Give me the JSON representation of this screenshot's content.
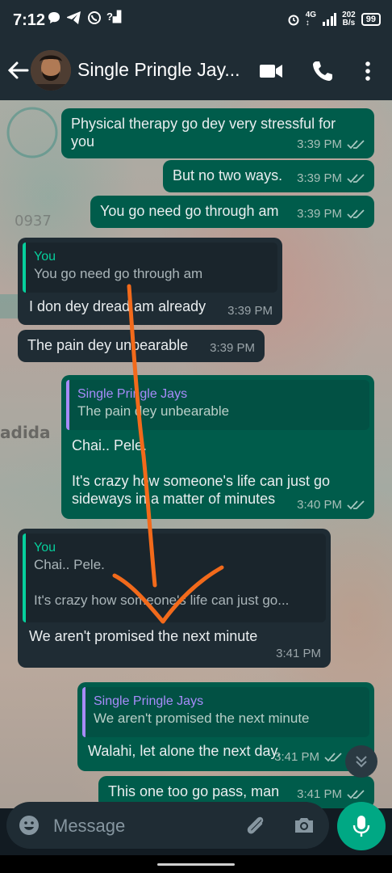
{
  "status_bar": {
    "time": "7:12",
    "left_icons": [
      "chat-bubble-icon",
      "telegram-icon",
      "whatsapp-icon",
      "signal-icon"
    ],
    "signal_label": "?",
    "network_label": "4G",
    "net_speed": "202",
    "net_speed_unit": "B/s",
    "battery": "99"
  },
  "header": {
    "contact_name": "Single Pringle Jay...",
    "icons": [
      "back-arrow-icon",
      "video-call-icon",
      "phone-icon",
      "more-vert-icon"
    ]
  },
  "messages": [
    {
      "dir": "out",
      "text": "Physical therapy go dey very stressful for you",
      "time": "3:39 PM",
      "ticks": "read"
    },
    {
      "dir": "out",
      "text": "But no two ways.",
      "time": "3:39 PM",
      "ticks": "read"
    },
    {
      "dir": "out",
      "text": "You go need go through am",
      "time": "3:39 PM",
      "ticks": "read"
    },
    {
      "dir": "in",
      "quote_author": "You",
      "quote_text": "You go need go through am",
      "text": "I don dey dread am already",
      "time": "3:39 PM"
    },
    {
      "dir": "in",
      "text": "The pain dey unbearable",
      "time": "3:39 PM"
    },
    {
      "dir": "out",
      "quote_author": "Single Pringle Jays",
      "quote_text": "The pain dey unbearable",
      "text_line1": "Chai.. Pele.",
      "text_line2": "It's crazy how someone's life can just go sideways in a matter of minutes",
      "time": "3:40 PM",
      "ticks": "read"
    },
    {
      "dir": "in",
      "quote_author": "You",
      "quote_text_line1": "Chai.. Pele.",
      "quote_text_line2": "It's crazy how someone's life can just go...",
      "text": "We aren't promised the next minute",
      "time": "3:41 PM"
    },
    {
      "dir": "out",
      "quote_author": "Single Pringle Jays",
      "quote_text": "We aren't promised the next minute",
      "text": "Walahi, let alone the next day.",
      "time": "3:41 PM",
      "ticks": "read"
    },
    {
      "dir": "out",
      "text": "This one too go pass, man",
      "time": "3:41 PM",
      "ticks": "read"
    }
  ],
  "composer": {
    "placeholder": "Message",
    "icons": [
      "emoji-icon",
      "attach-icon",
      "camera-icon",
      "mic-icon"
    ]
  },
  "colors": {
    "outgoing_bubble": "#005c4b",
    "incoming_bubble": "#1f2c34",
    "accent": "#00a884",
    "annotation_arrow": "#f26a1b"
  }
}
